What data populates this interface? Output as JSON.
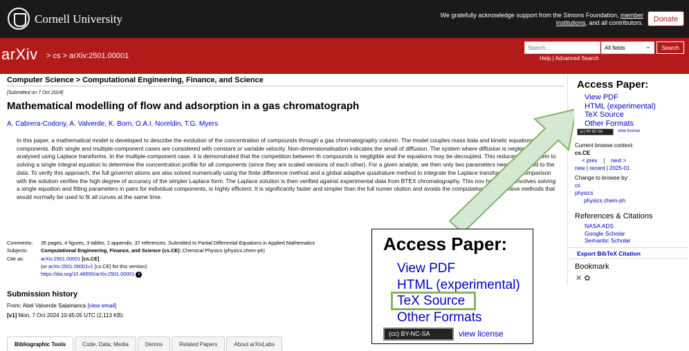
{
  "cornell": {
    "name": "Cornell University",
    "ack_line1": "We gratefully acknowledge support from the Simons Foundation, ",
    "ack_link1": "member",
    "ack_link2": "institutions",
    "ack_line2": ", and all contributors.",
    "donate": "Donate"
  },
  "header": {
    "logo": "arXiv",
    "breadcrumb": "> cs > arXiv:2501.00001",
    "search_placeholder": "Search...",
    "field_select": "All fields",
    "search_button": "Search",
    "help_link": "Help | Advanced Search"
  },
  "paper": {
    "subject_header": "Computer Science > Computational Engineering, Finance, and Science",
    "submitted": "[Submitted on 7 Oct 2024]",
    "title": "Mathematical modelling of flow and adsorption in a gas chromatograph",
    "authors": "A. Cabrera-Codony, A. Valverde, K. Born, O.A.I. Noreldin, T.G. Myers",
    "abstract": "In this paper, a mathematical model is developed to describe the evolution of the concentration of compounds through a gas chromatography column. The model couples mass bala and kinetic equations for all components. Both single and multiple-component cases are considered with constant or variable velocity. Non-dimensionalisation indicates the small of diffusion. The system where diffusion is neglected is analysed using Laplace transforms. In the multiple-component case, it is demonstrated that the competition between th compounds is negligible and the equations may be decoupled. This reduces the problem to solving a single integral equation to determine the concentration profile for all components (since they are scaled versions of each other). For a given analyte, we then only two parameters need to be fitted to the data. To verify this approach, the full governin ations are also solved numerically using the finite difference method and a global adaptive quadrature method to integrate the Laplace transformation. Comparison with the solution verifies the high degree of accuracy of the simpler Laplace form. The Laplace solution is then verified against experimental data from BTEX chromatography. This nov hod, which involves solving a single equation and fitting parameters in pairs for individual components, is highly efficient. It is significantly faster and simpler than the full numer olution and avoids the computationally expensive methods that would normally be used to fit all curves at the same time."
  },
  "meta": {
    "comments_label": "Comments:",
    "comments": "35 pages, 4 figures, 3 tables, 2 appendix, 37 references. Submitted to Partial Differential Equations in Applied Mathematics",
    "subjects_label": "Subjects:",
    "subjects_bold": "Computational Engineering, Finance, and Science (cs.CE)",
    "subjects_rest": "; Chemical Physics (physics.chem-ph)",
    "cite_label": "Cite as:",
    "cite_id": "arXiv:2501.00001",
    "cite_tag": " [cs.CE]",
    "cite_version_pre": "(or ",
    "cite_version_link": "arXiv:2501.00001v1",
    "cite_version_post": " [cs.CE] for this version)",
    "doi": "https://doi.org/10.48550/arXiv.2501.00001"
  },
  "history": {
    "heading": "Submission history",
    "from_pre": "From: Abel Valverde Salamanca ",
    "from_link": "[view email]",
    "v1_tag": "[v1]",
    "v1_text": " Mon, 7 Oct 2024 10:45:05 UTC (2,113 KB)"
  },
  "tabs": [
    "Bibliographic Tools",
    "Code, Data, Media",
    "Demos",
    "Related Papers",
    "About arXivLabs"
  ],
  "sidebar": {
    "access_heading": "Access Paper:",
    "access_links": [
      "View PDF",
      "HTML (experimental)",
      "TeX Source",
      "Other Formats"
    ],
    "license_badge": "(cc) BY-NC-SA",
    "view_license": "view license",
    "browse_context_label": "Current browse context:",
    "browse_context": "cs.CE",
    "prev": "< prev",
    "sep": "|",
    "next": "next >",
    "new": "new",
    "recent": "recent",
    "month": "2025-01",
    "change_browse": "Change to browse by:",
    "browse_cs": "cs",
    "browse_physics": "physics",
    "browse_chem": "physics.chem-ph",
    "refs_heading": "References & Citations",
    "refs": [
      "NASA ADS",
      "Google Scholar",
      "Semantic Scholar"
    ],
    "bibtex": "Export BibTeX Citation",
    "bookmark": "Bookmark"
  },
  "callout": {
    "heading": "Access Paper:",
    "links": [
      "View PDF",
      "HTML (experimental)",
      "TeX Source",
      "Other Formats"
    ],
    "license_badge": "(cc) BY-NC-SA",
    "view_license": "view license",
    "highlight_color": "#82b366"
  },
  "colors": {
    "arxiv_red": "#b31b1b",
    "link_blue": "#0000c8",
    "arrow_green_fill": "#d5e8d4",
    "arrow_green_stroke": "#82b366"
  }
}
